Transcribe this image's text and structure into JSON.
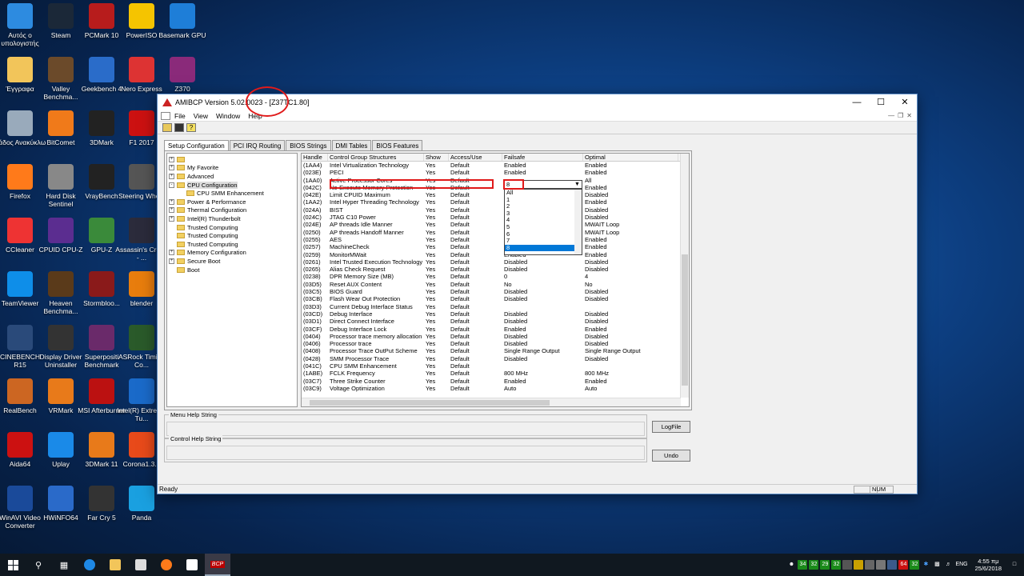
{
  "desktop": {
    "icons": [
      {
        "label": "Αυτός ο υπολογιστής",
        "icon": "computer-icon",
        "color": "#2d8be0"
      },
      {
        "label": "Steam",
        "icon": "steam-icon",
        "color": "#1b2838"
      },
      {
        "label": "PCMark 10",
        "icon": "pcmark-icon",
        "color": "#b71c1c"
      },
      {
        "label": "PowerISO",
        "icon": "poweriso-icon",
        "color": "#f5c400"
      },
      {
        "label": "Basemark GPU",
        "icon": "basemark-icon",
        "color": "#1e7ed8"
      },
      {
        "label": "Έγγραφα",
        "icon": "documents-icon",
        "color": "#f2c55a"
      },
      {
        "label": "Valley Benchma...",
        "icon": "valley-icon",
        "color": "#6b4a2a"
      },
      {
        "label": "Geekbench 4",
        "icon": "geekbench-icon",
        "color": "#2a6cc9"
      },
      {
        "label": "Nero Express",
        "icon": "nero-icon",
        "color": "#d33"
      },
      {
        "label": "Z370",
        "icon": "winrar-icon",
        "color": "#8a2a7a"
      },
      {
        "label": "Κάδος Ανακύκλω",
        "icon": "recycle-bin-icon",
        "color": "#9ab"
      },
      {
        "label": "BitComet",
        "icon": "bitcomet-icon",
        "color": "#f07a1a"
      },
      {
        "label": "3DMark",
        "icon": "3dmark-icon",
        "color": "#222"
      },
      {
        "label": "F1 2017",
        "icon": "f1-icon",
        "color": "#c11"
      },
      {
        "label": "Firefox",
        "icon": "firefox-icon",
        "color": "#ff7a1a"
      },
      {
        "label": "Hard Disk Sentinel",
        "icon": "hdsentinel-icon",
        "color": "#888"
      },
      {
        "label": "VrayBench",
        "icon": "vray-icon",
        "color": "#222"
      },
      {
        "label": "Steering Wheel",
        "icon": "steering-wheel-icon",
        "color": "#555"
      },
      {
        "label": "CCleaner",
        "icon": "ccleaner-icon",
        "color": "#e33"
      },
      {
        "label": "CPUID CPU-Z",
        "icon": "cpuz-icon",
        "color": "#5b2d90"
      },
      {
        "label": "GPU-Z",
        "icon": "gpuz-icon",
        "color": "#3a8a3a"
      },
      {
        "label": "Assassin's Creed - ...",
        "icon": "assassins-creed-icon",
        "color": "#2b2b3b"
      },
      {
        "label": "TeamViewer",
        "icon": "teamviewer-icon",
        "color": "#0e8ee9"
      },
      {
        "label": "Heaven Benchma...",
        "icon": "heaven-icon",
        "color": "#5a3a1a"
      },
      {
        "label": "Stormbloo...",
        "icon": "stormblood-icon",
        "color": "#8a1a1a"
      },
      {
        "label": "blender",
        "icon": "blender-icon",
        "color": "#e87d0d"
      },
      {
        "label": "CINEBENCH R15",
        "icon": "cinebench-icon",
        "color": "#2a4a7a"
      },
      {
        "label": "Display Driver Uninstaller",
        "icon": "ddu-icon",
        "color": "#333"
      },
      {
        "label": "Superpositi Benchmark",
        "icon": "superposition-icon",
        "color": "#6a2a6a"
      },
      {
        "label": "ASRock Timing Co...",
        "icon": "asrock-icon",
        "color": "#2a5a2a"
      },
      {
        "label": "RealBench",
        "icon": "realbench-icon",
        "color": "#c62"
      },
      {
        "label": "VRMark",
        "icon": "vrmark-icon",
        "color": "#e87a1a"
      },
      {
        "label": "MSI Afterburner",
        "icon": "afterburner-icon",
        "color": "#b11"
      },
      {
        "label": "Intel(R) Extreme Tu...",
        "icon": "intel-xtu-icon",
        "color": "#1a6ac9"
      },
      {
        "label": "Aida64",
        "icon": "aida64-icon",
        "color": "#c11"
      },
      {
        "label": "Uplay",
        "icon": "uplay-icon",
        "color": "#1a8ae8"
      },
      {
        "label": "3DMark 11",
        "icon": "3dmark11-icon",
        "color": "#e87a1a"
      },
      {
        "label": "Corona1.3...",
        "icon": "corona-icon",
        "color": "#e84a1a"
      },
      {
        "label": "WinAVI Video Converter",
        "icon": "winavi-icon",
        "color": "#1a4a9a"
      },
      {
        "label": "HWiNFO64",
        "icon": "hwinfo-icon",
        "color": "#2a6ac9"
      },
      {
        "label": "Far Cry 5",
        "icon": "farcry5-icon",
        "color": "#333"
      },
      {
        "label": "Panda",
        "icon": "panda-icon",
        "color": "#1aa0e0"
      }
    ]
  },
  "window": {
    "title_prefix": "AMIBCP Version 5.02.0023 -",
    "title_rom": "Z37TC1.80",
    "menu": [
      "File",
      "View",
      "Window",
      "Help"
    ],
    "tabs": [
      "Setup Configuration",
      "PCI IRQ Routing",
      "BIOS Strings",
      "DMI Tables",
      "BIOS Features"
    ],
    "tree": [
      {
        "label": "",
        "exp": "+",
        "indent": 0
      },
      {
        "label": "My Favorite",
        "exp": "+",
        "indent": 0
      },
      {
        "label": "Advanced",
        "exp": "+",
        "indent": 0
      },
      {
        "label": "CPU Configuration",
        "exp": "-",
        "indent": 0,
        "selected": true
      },
      {
        "label": "CPU SMM Enhancement",
        "exp": "",
        "indent": 1
      },
      {
        "label": "Power & Performance",
        "exp": "+",
        "indent": 0
      },
      {
        "label": "Thermal Configuration",
        "exp": "+",
        "indent": 0
      },
      {
        "label": "Intel(R) Thunderbolt",
        "exp": "+",
        "indent": 0
      },
      {
        "label": "Trusted Computing",
        "exp": "",
        "indent": 0
      },
      {
        "label": "Trusted Computing",
        "exp": "",
        "indent": 0
      },
      {
        "label": "Trusted Computing",
        "exp": "",
        "indent": 0
      },
      {
        "label": "Memory Configuration",
        "exp": "+",
        "indent": 0
      },
      {
        "label": "Secure Boot",
        "exp": "+",
        "indent": 0
      },
      {
        "label": "Boot",
        "exp": "",
        "indent": 0
      }
    ],
    "columns": [
      "Handle",
      "Control Group Structures",
      "Show",
      "Access/Use",
      "Failsafe",
      "Optimal"
    ],
    "rows": [
      [
        "(1AA4)",
        "Intel Virtualization Technology",
        "Yes",
        "Default",
        "Enabled",
        "Enabled"
      ],
      [
        "(023E)",
        "PECI",
        "Yes",
        "Default",
        "Enabled",
        "Enabled"
      ],
      [
        "(1AA0)",
        "Active Processor Cores",
        "Yes",
        "Default",
        "",
        "All"
      ],
      [
        "(042C)",
        "No-Execute Memory Protection",
        "Yes",
        "Default",
        "",
        "Enabled"
      ],
      [
        "(042E)",
        "Limit CPUID Maximum",
        "Yes",
        "Default",
        "",
        "Disabled"
      ],
      [
        "(1AA2)",
        "Intel Hyper Threading Technology",
        "Yes",
        "Default",
        "",
        "Enabled"
      ],
      [
        "(024A)",
        "BIST",
        "Yes",
        "Default",
        "",
        "Disabled"
      ],
      [
        "(024C)",
        "JTAG C10 Power",
        "Yes",
        "Default",
        "",
        "Disabled"
      ],
      [
        "(024E)",
        "AP threads Idle Manner",
        "Yes",
        "Default",
        "",
        "MWAIT Loop"
      ],
      [
        "(0250)",
        "AP threads Handoff Manner",
        "Yes",
        "Default",
        "",
        "MWAIT Loop"
      ],
      [
        "(0255)",
        "AES",
        "Yes",
        "Default",
        "",
        "Enabled"
      ],
      [
        "(0257)",
        "MachineCheck",
        "Yes",
        "Default",
        "",
        "Enabled"
      ],
      [
        "(0259)",
        "MonitorMWait",
        "Yes",
        "Default",
        "Enabled",
        "Enabled"
      ],
      [
        "(0261)",
        "Intel Trusted Execution Technology",
        "Yes",
        "Default",
        "Disabled",
        "Disabled"
      ],
      [
        "(0265)",
        "Alias Check Request",
        "Yes",
        "Default",
        "Disabled",
        "Disabled"
      ],
      [
        "(0238)",
        "DPR Memory Size (MB)",
        "Yes",
        "Default",
        "0",
        "4"
      ],
      [
        "(03D5)",
        "Reset AUX Content",
        "Yes",
        "Default",
        "No",
        "No"
      ],
      [
        "(03C5)",
        "BIOS Guard",
        "Yes",
        "Default",
        "Disabled",
        "Disabled"
      ],
      [
        "(03CB)",
        "Flash Wear Out Protection",
        "Yes",
        "Default",
        "Disabled",
        "Disabled"
      ],
      [
        "(03D3)",
        "Current Debug Interface Status",
        "Yes",
        "Default",
        "",
        ""
      ],
      [
        "(03CD)",
        "Debug Interface",
        "Yes",
        "Default",
        "Disabled",
        "Disabled"
      ],
      [
        "(03D1)",
        "Direct Connect Interface",
        "Yes",
        "Default",
        "Disabled",
        "Disabled"
      ],
      [
        "(03CF)",
        "Debug Interface Lock",
        "Yes",
        "Default",
        "Enabled",
        "Enabled"
      ],
      [
        "(0404)",
        "Processor trace memory allocation",
        "Yes",
        "Default",
        "Disabled",
        "Disabled"
      ],
      [
        "(0406)",
        "Processor trace",
        "Yes",
        "Default",
        "Disabled",
        "Disabled"
      ],
      [
        "(0408)",
        "Processor Trace OutPut Scheme",
        "Yes",
        "Default",
        "Single Range Output",
        "Single Range Output"
      ],
      [
        "(0428)",
        "SMM Processor Trace",
        "Yes",
        "Default",
        "Disabled",
        "Disabled"
      ],
      [
        "(041C)",
        "CPU SMM Enhancement",
        "Yes",
        "Default",
        "",
        ""
      ],
      [
        "(1ABE)",
        "FCLK Frequency",
        "Yes",
        "Default",
        "800 MHz",
        "800 MHz"
      ],
      [
        "(03C7)",
        "Three Strike Counter",
        "Yes",
        "Default",
        "Enabled",
        "Enabled"
      ],
      [
        "(03C9)",
        "Voltage Optimization",
        "Yes",
        "Default",
        "Auto",
        "Auto"
      ]
    ],
    "dropdown": {
      "value": "8",
      "options": [
        "All",
        "1",
        "2",
        "3",
        "4",
        "5",
        "6",
        "7",
        "8"
      ],
      "selected_index": 8
    },
    "menu_help_label": "Menu Help String",
    "control_help_label": "Control Help String",
    "logfile_label": "LogFile",
    "undo_label": "Undo",
    "status": "Ready",
    "num": "NUM"
  },
  "taskbar": {
    "tray_numbers": [
      "34",
      "32",
      "29",
      "32"
    ],
    "tray_numbers2": [
      "64",
      "32"
    ],
    "lang": "ENG",
    "time": "4:55 πμ",
    "date": "25/6/2018",
    "bcp_label": "BCP"
  },
  "colors": {
    "highlight": "#e01a1a",
    "selection": "#0078d7"
  }
}
